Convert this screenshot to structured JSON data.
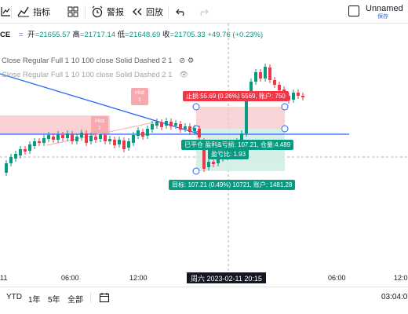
{
  "toolbar": {
    "indicators_label": "指标",
    "alert_label": "警报",
    "replay_label": "回放",
    "layout_name": "Unnamed",
    "save_label": "保存"
  },
  "legend": {
    "symbol": "CE",
    "open_label": "开",
    "open": "=21655.57",
    "high_label": "高",
    "high": "=21717.14",
    "low_label": "低",
    "low": "=21648.69",
    "close_label": "收",
    "close": "=21705.33",
    "change": "+49.76 (+0.23%)"
  },
  "indicators": [
    {
      "text": "Close Regular Full 1 10 100 close Solid Dashed 2 1",
      "icons": "⊘ ⚙"
    },
    {
      "text": "Close Regular Full 1 10 100 close Solid Dashed 2 1",
      "icons": "👁"
    }
  ],
  "hist_labels": [
    "Hist\n1",
    "Hist\n1"
  ],
  "position": {
    "stop_label": "止损:55.69 (0.26%) 5569, 账户: 750",
    "close_label": "已平仓 盈利&亏损: 107.21, 仓量:4.489",
    "ratio_label": "盈亏比: 1.93",
    "target_label": "目标: 107.21 (0.49%) 10721, 账户: 1481.28"
  },
  "time_axis": {
    "labels": [
      "11",
      "06:00",
      "12:00",
      "06:00",
      "12:0"
    ],
    "crosshair": "周六 2023-02-11   20:15"
  },
  "bottom": {
    "ranges": [
      "YTD",
      "1年",
      "5年",
      "全部"
    ],
    "clock": "03:04:0"
  },
  "colors": {
    "up": "#089981",
    "down": "#f23645",
    "trend": "#2962ff",
    "stop_zone": "#f7c6ca",
    "target_zone": "#cfece4"
  }
}
